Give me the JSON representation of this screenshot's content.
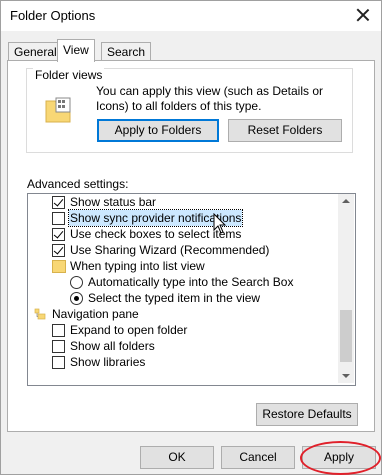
{
  "window": {
    "title": "Folder Options"
  },
  "tabs": [
    "General",
    "View",
    "Search"
  ],
  "folder_views": {
    "label": "Folder views",
    "description": "You can apply this view (such as Details or Icons) to all folders of this type.",
    "apply_button": "Apply to Folders",
    "reset_button": "Reset Folders"
  },
  "advanced": {
    "label": "Advanced settings:",
    "items": [
      {
        "type": "checkbox",
        "checked": true,
        "label": "Show status bar"
      },
      {
        "type": "checkbox",
        "checked": false,
        "label": "Show sync provider notifications",
        "selected": true
      },
      {
        "type": "checkbox",
        "checked": true,
        "label": "Use check boxes to select items"
      },
      {
        "type": "checkbox",
        "checked": true,
        "label": "Use Sharing Wizard (Recommended)"
      },
      {
        "type": "folder",
        "label": "When typing into list view"
      },
      {
        "type": "radio",
        "checked": false,
        "label": "Automatically type into the Search Box"
      },
      {
        "type": "radio",
        "checked": true,
        "label": "Select the typed item in the view"
      },
      {
        "type": "nav",
        "label": "Navigation pane"
      },
      {
        "type": "checkbox",
        "checked": false,
        "label": "Expand to open folder"
      },
      {
        "type": "checkbox",
        "checked": false,
        "label": "Show all folders"
      },
      {
        "type": "checkbox",
        "checked": false,
        "label": "Show libraries"
      }
    ]
  },
  "restore_button": "Restore Defaults",
  "footer": {
    "ok": "OK",
    "cancel": "Cancel",
    "apply": "Apply"
  },
  "annotation_color": "#e0202a"
}
